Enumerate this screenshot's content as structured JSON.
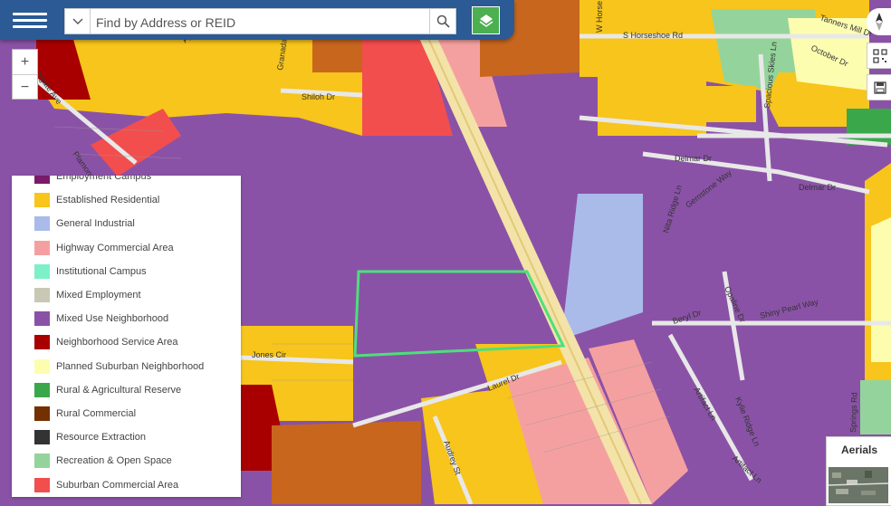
{
  "header": {
    "search_placeholder": "Find by Address or REID"
  },
  "controls": {
    "zoom_in": "+",
    "zoom_out": "−",
    "aerials_label": "Aerials"
  },
  "legend": {
    "items": [
      {
        "label": "Employment Campus",
        "color": "#7a1a6a"
      },
      {
        "label": "Established Residential",
        "color": "#f7c51b"
      },
      {
        "label": "General Industrial",
        "color": "#aabbea"
      },
      {
        "label": "Highway Commercial Area",
        "color": "#f5a0a0"
      },
      {
        "label": "Institutional Campus",
        "color": "#7ef0c8"
      },
      {
        "label": "Mixed Employment",
        "color": "#c8c8b4"
      },
      {
        "label": "Mixed Use Neighborhood",
        "color": "#8a52a6"
      },
      {
        "label": "Neighborhood Service Area",
        "color": "#a80000"
      },
      {
        "label": "Planned Suburban Neighborhood",
        "color": "#fdfdb0"
      },
      {
        "label": "Rural & Agricultural Reserve",
        "color": "#3aa84a"
      },
      {
        "label": "Rural Commercial",
        "color": "#733000"
      },
      {
        "label": "Resource Extraction",
        "color": "#333333"
      },
      {
        "label": "Recreation & Open Space",
        "color": "#94d49c"
      },
      {
        "label": "Suburban Commercial Area",
        "color": "#f24e4e"
      }
    ]
  },
  "map": {
    "street_labels": {
      "horseshoe": "S Horseshoe Rd",
      "shiloh": "Shiloh Dr",
      "delmar1": "Delmar Dr",
      "delmar2": "Delmar Dr",
      "jones": "Jones Cir",
      "laurel": "Laurel Dr",
      "audrey": "Audrey St",
      "beryl": "Beryl Dr",
      "shiny": "Shiny Pearl Way",
      "gemstone": "Gemstone Way",
      "nita": "Nita Ridge Ln",
      "opal": "Opaline Dr",
      "kylie": "Kylie Ridge Ln",
      "artifact1": "Artifact Ln",
      "artifact2": "Artifact Ln",
      "tanners": "Tanners Mill Dr",
      "october": "October Dr",
      "spacious": "Spacious Skies Ln",
      "granada": "Granada",
      "whorse": "W Horse",
      "ngate": "Ngate Ave",
      "springs": "Springs Rd",
      "pleasant": "Pleasant",
      "plamondon": "Plamondon"
    },
    "colors": {
      "mixed_use": "#8a52a6",
      "residential": "#f7c51b",
      "industrial": "#aabbea",
      "highway_commercial": "#f5a0a0",
      "suburban_commercial": "#f24e4e",
      "neighborhood_service": "#a80000",
      "rural_commercial": "#c8661e",
      "recreation": "#94d49c",
      "planned_suburban": "#fdfdb0",
      "rural_reserve": "#3aa84a",
      "selection": "#4ce07a",
      "accent": "#2b5a95"
    }
  }
}
